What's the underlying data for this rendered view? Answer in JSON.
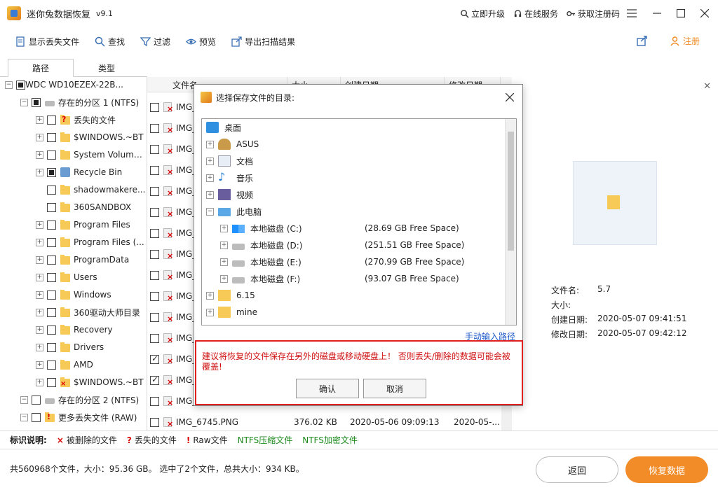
{
  "app": {
    "title": "迷你兔数据恢复",
    "version": "v9.1"
  },
  "title_links": [
    "立即升级",
    "在线服务",
    "获取注册码"
  ],
  "toolbar": {
    "show_lost": "显示丢失文件",
    "find": "查找",
    "filter": "过滤",
    "preview": "预览",
    "export": "导出扫描结果",
    "register": "注册"
  },
  "tabs": {
    "path": "路径",
    "type": "类型"
  },
  "tree": [
    {
      "label": "WDC WD10EZEX-22B...",
      "indent": 0,
      "icon": "disk"
    },
    {
      "label": "存在的分区 1 (NTFS)",
      "indent": 1,
      "icon": "drive"
    },
    {
      "label": "丢失的文件",
      "indent": 2,
      "icon": "lost"
    },
    {
      "label": "$WINDOWS.~BT",
      "indent": 2,
      "icon": "folder"
    },
    {
      "label": "System Volume ...",
      "indent": 2,
      "icon": "folder"
    },
    {
      "label": "Recycle Bin",
      "indent": 2,
      "icon": "recycle"
    },
    {
      "label": "shadowmakere...",
      "indent": 2,
      "icon": "folder"
    },
    {
      "label": "360SANDBOX",
      "indent": 2,
      "icon": "folder"
    },
    {
      "label": "Program Files",
      "indent": 2,
      "icon": "folder"
    },
    {
      "label": "Program Files (...",
      "indent": 2,
      "icon": "folder"
    },
    {
      "label": "ProgramData",
      "indent": 2,
      "icon": "folder"
    },
    {
      "label": "Users",
      "indent": 2,
      "icon": "folder"
    },
    {
      "label": "Windows",
      "indent": 2,
      "icon": "folder"
    },
    {
      "label": "360驱动大师目录",
      "indent": 2,
      "icon": "folder"
    },
    {
      "label": "Recovery",
      "indent": 2,
      "icon": "folder"
    },
    {
      "label": "Drivers",
      "indent": 2,
      "icon": "folder"
    },
    {
      "label": "AMD",
      "indent": 2,
      "icon": "folder"
    },
    {
      "label": "$WINDOWS.~BT",
      "indent": 2,
      "icon": "folder-del"
    },
    {
      "label": "存在的分区 2 (NTFS)",
      "indent": 1,
      "icon": "drive"
    },
    {
      "label": "更多丢失文件 (RAW)",
      "indent": 1,
      "icon": "raw"
    }
  ],
  "files": {
    "headers": [
      "文件名",
      "大小",
      "创建日期",
      "修改日期"
    ],
    "row_labels": [
      "IMG_",
      "IMG_",
      "IMG_",
      "IMG_",
      "IMG_",
      "IMG_",
      "IMG_",
      "IMG_",
      "IMG_",
      "IMG_",
      "IMG_",
      "IMG_",
      "IMG_",
      "IMG_",
      "IMG_"
    ],
    "checked": [
      false,
      false,
      false,
      false,
      false,
      false,
      false,
      false,
      false,
      false,
      false,
      false,
      true,
      true,
      false
    ],
    "last_row": {
      "name": "IMG_6745.PNG",
      "size": "376.02 KB",
      "created": "2020-05-06 09:09:13",
      "modified": "2020-05-..."
    }
  },
  "preview": {
    "labels": {
      "name": "文件名:",
      "size": "大小:",
      "created": "创建日期:",
      "modified": "修改日期:"
    },
    "values": {
      "name": "5.7",
      "size": "",
      "created": "2020-05-07 09:41:51",
      "modified": "2020-05-07 09:42:12"
    }
  },
  "legend": {
    "title": "标识说明:",
    "deleted": "被删除的文件",
    "lost": "丢失的文件",
    "raw": "Raw文件",
    "ntfs_compressed": "NTFS压缩文件",
    "ntfs_encrypted": "NTFS加密文件"
  },
  "status": {
    "summary": "共560968个文件，大小：95.36 GB。 选中了2个文件，总共大小：934 KB。",
    "back": "返回",
    "recover": "恢复数据"
  },
  "dialog": {
    "title": "选择保存文件的目录:",
    "items": [
      {
        "label": "桌面",
        "free": "",
        "level": 0,
        "icon": "desktop"
      },
      {
        "label": "ASUS",
        "free": "",
        "level": 1,
        "icon": "user"
      },
      {
        "label": "文档",
        "free": "",
        "level": 1,
        "icon": "doc"
      },
      {
        "label": "音乐",
        "free": "",
        "level": 1,
        "icon": "music"
      },
      {
        "label": "视频",
        "free": "",
        "level": 1,
        "icon": "video"
      },
      {
        "label": "此电脑",
        "free": "",
        "level": 1,
        "icon": "pc"
      },
      {
        "label": "本地磁盘 (C:)",
        "free": "(28.69 GB Free Space)",
        "level": 2,
        "icon": "win-drive"
      },
      {
        "label": "本地磁盘 (D:)",
        "free": "(251.51 GB Free Space)",
        "level": 2,
        "icon": "hdd"
      },
      {
        "label": "本地磁盘 (E:)",
        "free": "(270.99 GB Free Space)",
        "level": 2,
        "icon": "hdd"
      },
      {
        "label": "本地磁盘 (F:)",
        "free": "(93.07 GB Free Space)",
        "level": 2,
        "icon": "hdd"
      },
      {
        "label": "6.15",
        "free": "",
        "level": 1,
        "icon": "folder"
      },
      {
        "label": "mine",
        "free": "",
        "level": 1,
        "icon": "folder"
      }
    ],
    "manual_path": "手动输入路径",
    "warning": "建议将恢复的文件保存在另外的磁盘或移动硬盘上！ 否则丢失/删除的数据可能会被覆盖!",
    "ok": "确认",
    "cancel": "取消"
  }
}
